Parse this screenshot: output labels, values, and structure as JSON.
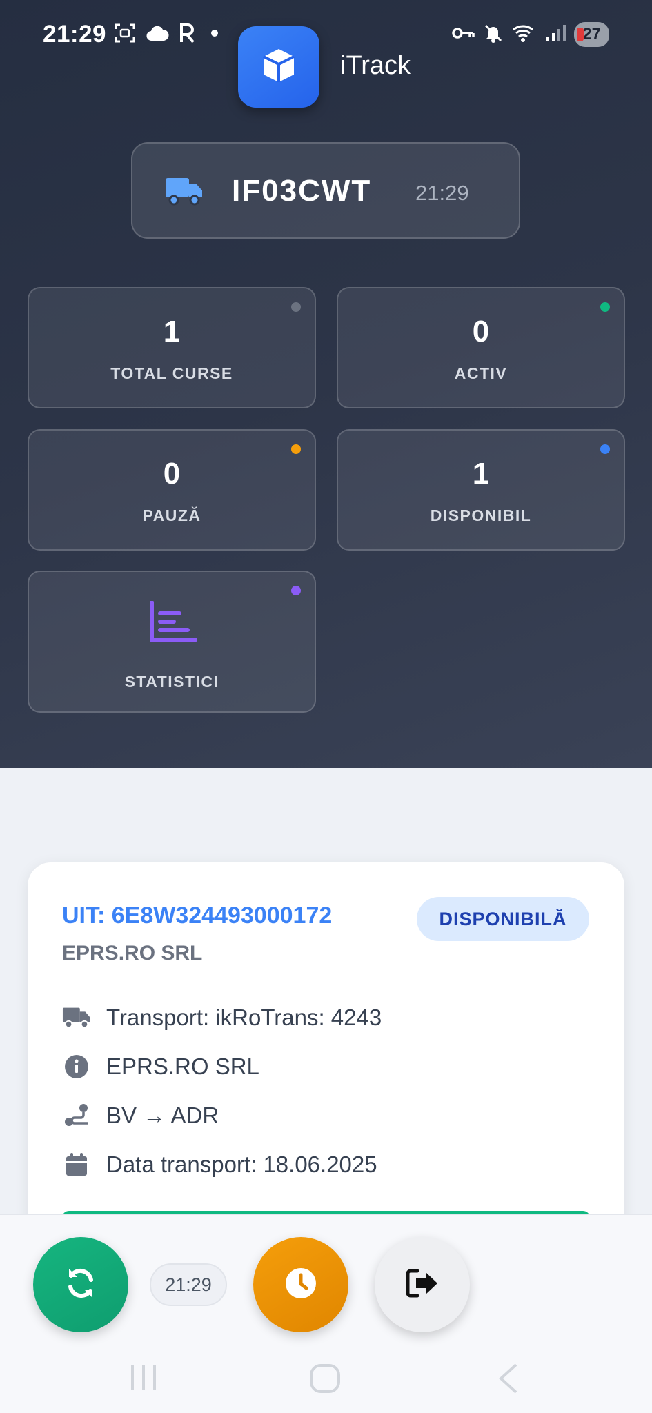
{
  "status_bar": {
    "time": "21:29",
    "battery": "27"
  },
  "app": {
    "name": "iTrack"
  },
  "vehicle": {
    "plate": "IF03CWT",
    "time": "21:29"
  },
  "stats": [
    {
      "value": "1",
      "label": "TOTAL CURSE",
      "dot_color": "#6b7280"
    },
    {
      "value": "0",
      "label": "ACTIV",
      "dot_color": "#10b981"
    },
    {
      "value": "0",
      "label": "PAUZĂ",
      "dot_color": "#f59e0b"
    },
    {
      "value": "1",
      "label": "DISPONIBIL",
      "dot_color": "#3b82f6"
    }
  ],
  "statistics_tile": {
    "label": "STATISTICI",
    "dot_color": "#8b5cf6"
  },
  "course_card": {
    "uit": "UIT: 6E8W324493000172",
    "company": "EPRS.RO SRL",
    "status_badge": "DISPONIBILĂ",
    "transport": "Transport: ikRoTrans: 4243",
    "beneficiary": "EPRS.RO SRL",
    "route": "BV → ADR",
    "date": "Data transport: 18.06.2025"
  },
  "bottom_bar": {
    "time": "21:29"
  },
  "colors": {
    "accent": "#3b82f6",
    "active": "#10b981",
    "pause": "#f59e0b",
    "stats": "#8b5cf6"
  }
}
